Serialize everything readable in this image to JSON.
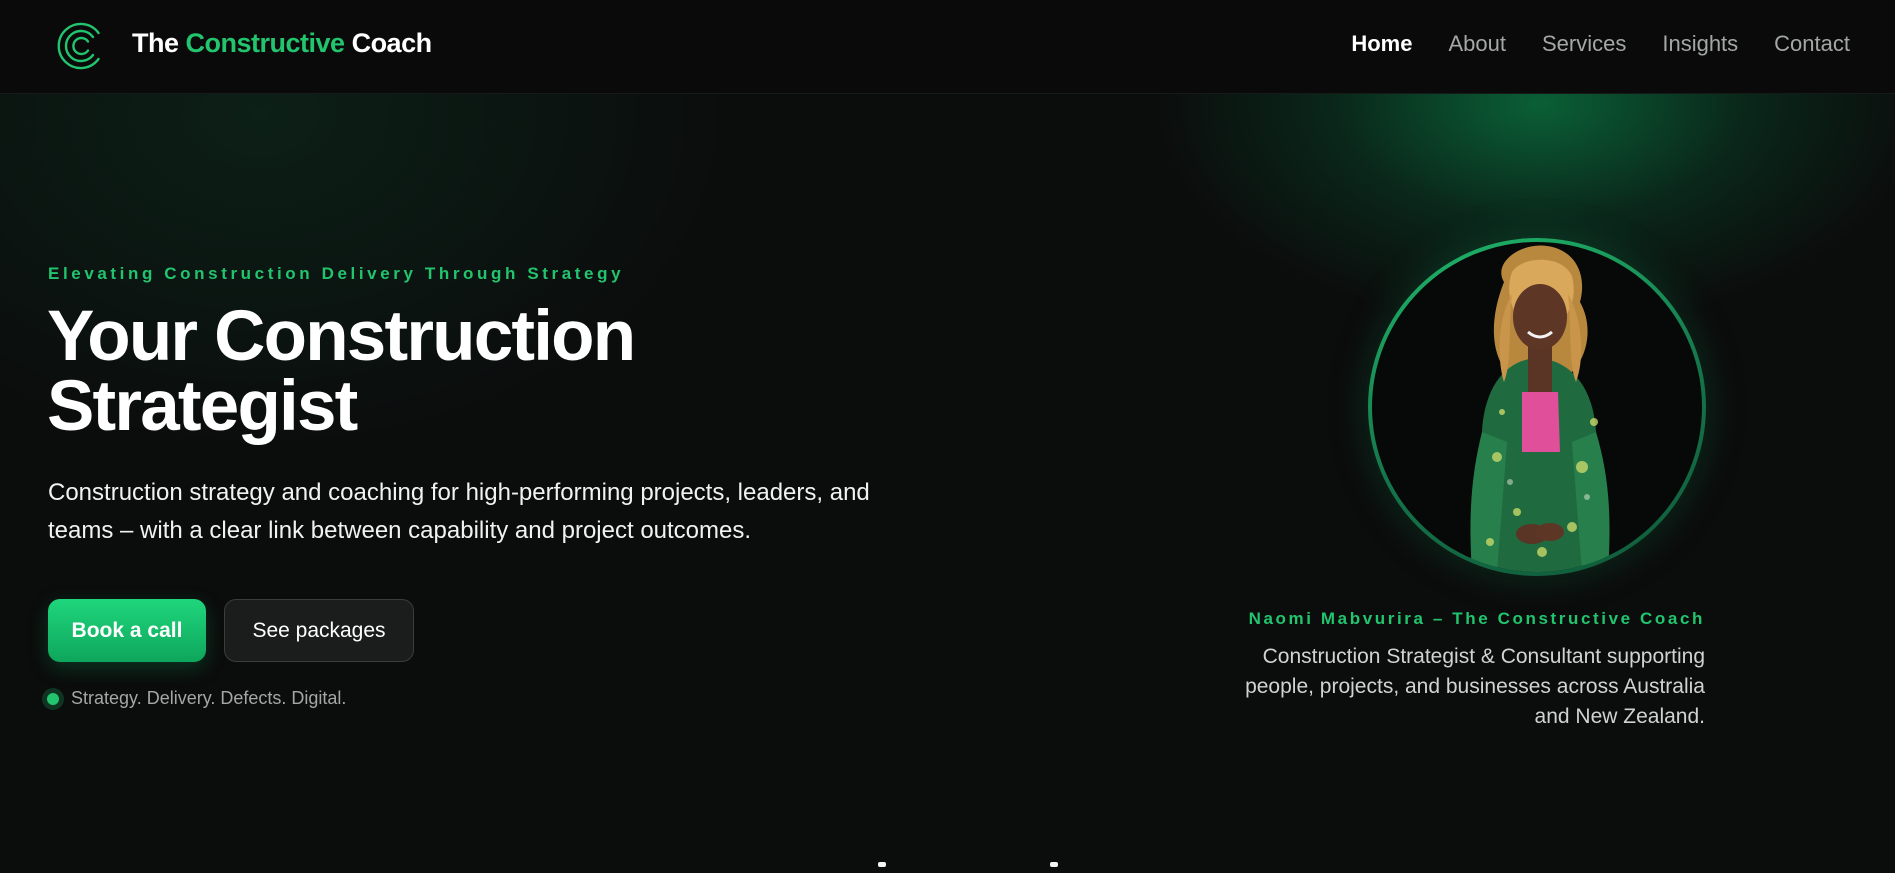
{
  "header": {
    "logo_icon": "concentric-c-logo-icon",
    "brand": {
      "prefix": "The ",
      "accent": "Constructive",
      "suffix": " Coach"
    },
    "nav": [
      {
        "label": "Home",
        "active": true
      },
      {
        "label": "About",
        "active": false
      },
      {
        "label": "Services",
        "active": false
      },
      {
        "label": "Insights",
        "active": false
      },
      {
        "label": "Contact",
        "active": false
      }
    ]
  },
  "hero": {
    "eyebrow": "Elevating Construction Delivery Through Strategy",
    "headline_line1": "Your Construction",
    "headline_line2": "Strategist",
    "lead": "Construction strategy and coaching for high-performing projects, leaders, and teams – with a clear link between capability and project outcomes.",
    "primary_cta": "Book a call",
    "secondary_cta": "See packages",
    "tagline": "Strategy. Delivery. Defects. Digital."
  },
  "profile": {
    "name_caption": "Naomi Mabvurira – The Constructive Coach",
    "description": "Construction Strategist & Consultant supporting people, projects, and businesses across Australia and New Zealand."
  },
  "colors": {
    "accent": "#22c46e",
    "background": "#0b0c0c",
    "nav_background": "#0a0a0a",
    "muted_text": "#a3a7a5"
  }
}
